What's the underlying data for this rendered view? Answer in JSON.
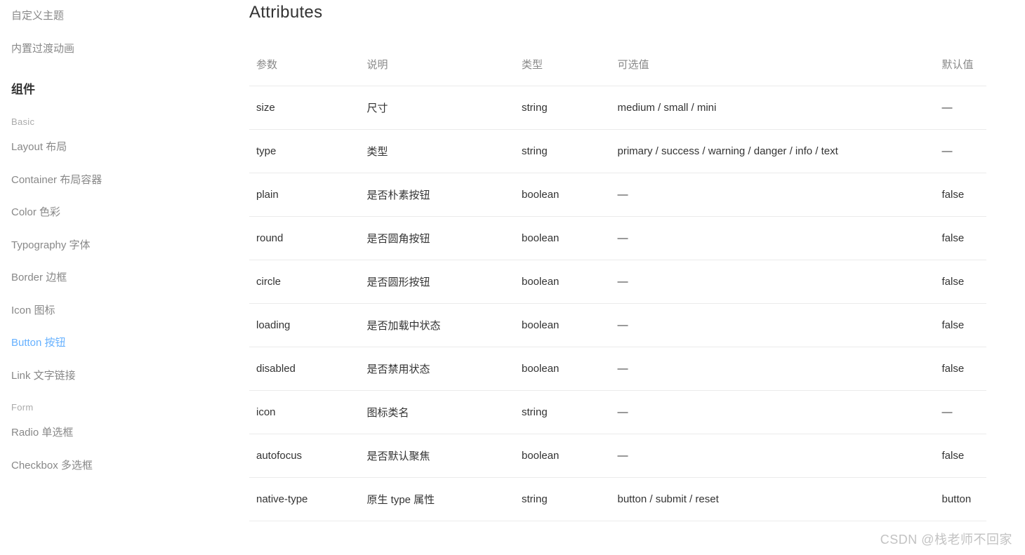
{
  "sidebar": {
    "top_items": [
      {
        "label": "自定义主题"
      },
      {
        "label": "内置过渡动画"
      }
    ],
    "heading": "组件",
    "groups": [
      {
        "title": "Basic",
        "items": [
          {
            "label": "Layout 布局",
            "active": false
          },
          {
            "label": "Container 布局容器",
            "active": false
          },
          {
            "label": "Color 色彩",
            "active": false
          },
          {
            "label": "Typography 字体",
            "active": false
          },
          {
            "label": "Border 边框",
            "active": false
          },
          {
            "label": "Icon 图标",
            "active": false
          },
          {
            "label": "Button 按钮",
            "active": true
          },
          {
            "label": "Link 文字链接",
            "active": false
          }
        ]
      },
      {
        "title": "Form",
        "items": [
          {
            "label": "Radio 单选框",
            "active": false
          },
          {
            "label": "Checkbox 多选框",
            "active": false
          }
        ]
      }
    ]
  },
  "main": {
    "title": "Attributes",
    "table": {
      "headers": [
        "参数",
        "说明",
        "类型",
        "可选值",
        "默认值"
      ],
      "rows": [
        {
          "param": "size",
          "desc": "尺寸",
          "type": "string",
          "options": "medium / small / mini",
          "default": "—"
        },
        {
          "param": "type",
          "desc": "类型",
          "type": "string",
          "options": "primary / success / warning / danger / info / text",
          "default": "—"
        },
        {
          "param": "plain",
          "desc": "是否朴素按钮",
          "type": "boolean",
          "options": "—",
          "default": "false"
        },
        {
          "param": "round",
          "desc": "是否圆角按钮",
          "type": "boolean",
          "options": "—",
          "default": "false"
        },
        {
          "param": "circle",
          "desc": "是否圆形按钮",
          "type": "boolean",
          "options": "—",
          "default": "false"
        },
        {
          "param": "loading",
          "desc": "是否加载中状态",
          "type": "boolean",
          "options": "—",
          "default": "false"
        },
        {
          "param": "disabled",
          "desc": "是否禁用状态",
          "type": "boolean",
          "options": "—",
          "default": "false"
        },
        {
          "param": "icon",
          "desc": "图标类名",
          "type": "string",
          "options": "—",
          "default": "—"
        },
        {
          "param": "autofocus",
          "desc": "是否默认聚焦",
          "type": "boolean",
          "options": "—",
          "default": "false"
        },
        {
          "param": "native-type",
          "desc": "原生 type 属性",
          "type": "string",
          "options": "button / submit / reset",
          "default": "button"
        }
      ]
    }
  },
  "watermark": "CSDN @栈老师不回家"
}
